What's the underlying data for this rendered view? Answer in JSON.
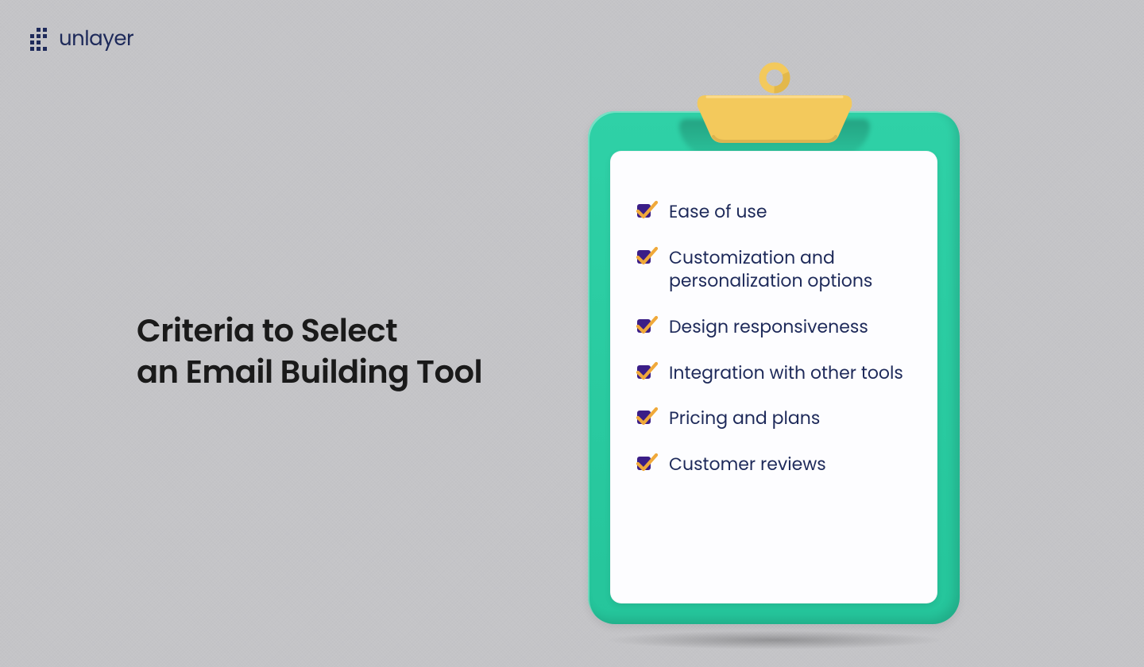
{
  "brand": {
    "name": "unlayer"
  },
  "headline": {
    "line1": "Criteria to Select",
    "line2": "an Email Building Tool"
  },
  "criteria": [
    {
      "label": "Ease of use"
    },
    {
      "label": "Customization and personalization options"
    },
    {
      "label": "Design responsiveness"
    },
    {
      "label": "Integration with other tools"
    },
    {
      "label": "Pricing and plans"
    },
    {
      "label": "Customer reviews"
    }
  ],
  "colors": {
    "background": "#c6c6c9",
    "board": "#2fd1a7",
    "clip": "#f3c95c",
    "text": "#1e2a5a",
    "checkbox": "#3b1e87",
    "tick": "#f0a93a"
  }
}
